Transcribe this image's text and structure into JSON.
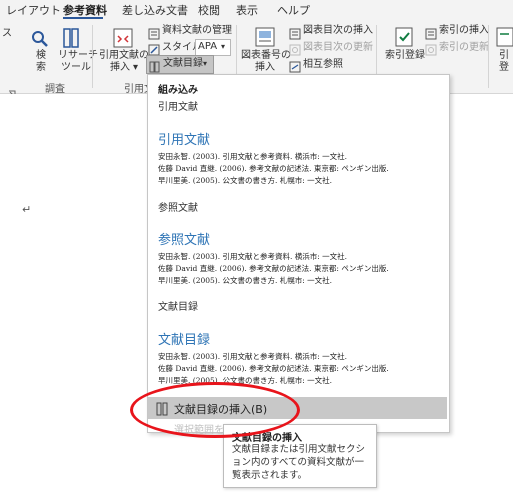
{
  "tabs": [
    {
      "label": "レイアウト",
      "active": false
    },
    {
      "label": "参考資料",
      "active": true
    },
    {
      "label": "差し込み文書",
      "active": false
    },
    {
      "label": "校閲",
      "active": false
    },
    {
      "label": "表示",
      "active": false
    },
    {
      "label": "ヘルプ",
      "active": false
    }
  ],
  "ribbon": {
    "left_cut_label": "ス",
    "search_label": [
      "検",
      "索"
    ],
    "researcher_label": [
      "リサーチ",
      "ツール"
    ],
    "research_group": "調査",
    "insert_citation": [
      "引用文献の",
      "挿入"
    ],
    "manage_sources": "資料文献の管理",
    "style_label": "スタイル:",
    "style_value": "APA",
    "bibliography_label": "文献目録",
    "citations_group": "引用文",
    "insert_caption": [
      "図表番号の",
      "挿入"
    ],
    "insert_table_of_figures": "図表目次の挿入",
    "update_table": "図表目次の更新",
    "cross_reference": "相互参照",
    "mark_entry": "索引登録",
    "insert_index": "索引の挿入",
    "update_index": "索引の更新",
    "mark_citation_cut": [
      "引",
      "登"
    ]
  },
  "dropdown": {
    "builtin_label": "組み込み",
    "items": [
      {
        "name": "引用文献",
        "heading": "引用文献",
        "entries": [
          "安田永智. (2003). 引用文献と参考資料. 横浜市: 一文社.",
          "佐藤 David 直継. (2006). 参考文献の記述法. 東京都: ペンギン出版.",
          "早川里美. (2005). 公文書の書き方. 札幌市: 一文社."
        ]
      },
      {
        "name": "参照文献",
        "heading": "参照文献",
        "entries": [
          "安田永智. (2003). 引用文献と参考資料. 横浜市: 一文社.",
          "佐藤 David 直継. (2006). 参考文献の記述法. 東京都: ペンギン出版.",
          "早川里美. (2005). 公文書の書き方. 札幌市: 一文社."
        ]
      },
      {
        "name": "文献目録",
        "heading": "文献目録",
        "entries": [
          "安田永智. (2003). 引用文献と参考資料. 横浜市: 一文社.",
          "佐藤 David 直継. (2006). 参考文献の記述法. 東京都: ペンギン出版.",
          "早川里美. (2005). 公文書の書き方. 札幌市: 一文社."
        ]
      }
    ],
    "insert_bibliography": "文献目録の挿入(B)",
    "save_selection_faded": "選択範囲を文"
  },
  "tooltip": {
    "title": "文献目録の挿入",
    "body": "文献目録または引用文献セクション内のすべての資料文献が一覧表示されます。"
  },
  "colors": {
    "accent": "#2b579a",
    "heading": "#2e74b5",
    "highlight_ring": "#e8141b",
    "hover_bg": "#c8c8c8"
  }
}
